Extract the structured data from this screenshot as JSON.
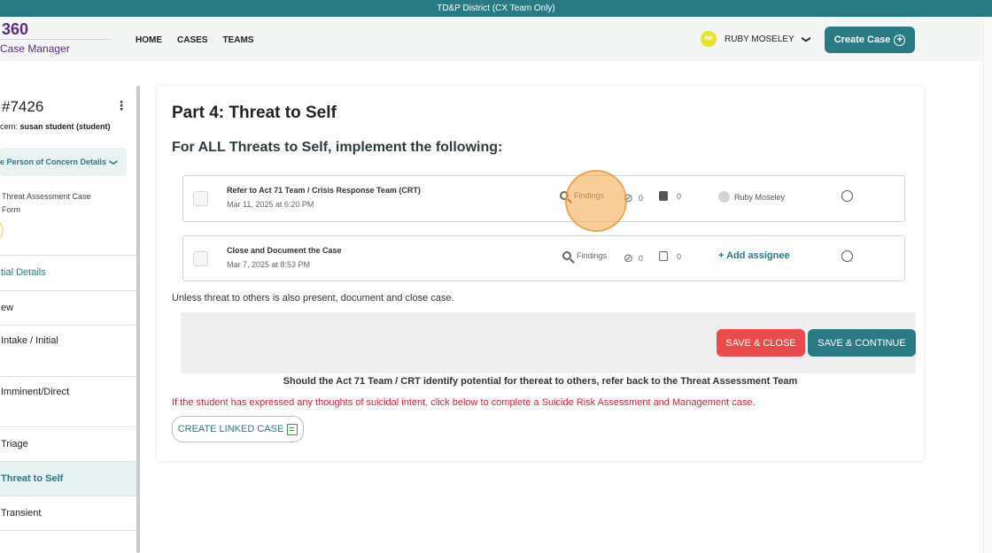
{
  "topbar": {
    "text": "TD&P District (CX Team Only)"
  },
  "header": {
    "logo_number": "360",
    "logo_subtitle": "Case Manager",
    "nav": [
      "HOME",
      "CASES",
      "TEAMS"
    ],
    "user": {
      "initials": "RM",
      "name": "RUBY MOSELEY",
      "caret": "❯"
    },
    "create_case": "Create Case",
    "plus": "+"
  },
  "sidebar": {
    "case_id": "#7426",
    "kebab": "⋮",
    "concern_prefix": "cern: ",
    "concern_name": "susan student (student)",
    "poc_button": "e Person of Concern Details",
    "poc_caret": "❯",
    "form_label_1": "Threat Assessment Case",
    "form_label_2": "Form",
    "items": [
      {
        "label": "tial Details"
      },
      {
        "label": "ew"
      },
      {
        "label": "Intake / Initial"
      },
      {
        "label": "Imminent/Direct"
      },
      {
        "label": "Triage"
      },
      {
        "label": "Threat to Self"
      },
      {
        "label": "Transient"
      }
    ]
  },
  "main": {
    "part_title": "Part 4: Threat to Self",
    "sub_title": "For ALL Threats to Self, implement the following:",
    "tasks": [
      {
        "title": "Refer to Act 71 Team / Crisis Response Team (CRT)",
        "date": "Mar 11, 2025 at 6:20 PM",
        "findings": "Findings",
        "attachments": "0",
        "notes": "0",
        "assignee": "Ruby Moseley"
      },
      {
        "title": "Close and Document the Case",
        "date": "Mar 7, 2025 at 8:53 PM",
        "findings": "Findings",
        "attachments": "0",
        "notes": "0",
        "assignee": "+ Add assignee"
      }
    ],
    "unless_text": "Unless threat to others is also present, document and close case.",
    "save_close": "SAVE & CLOSE",
    "save_continue": "SAVE & CONTINUE",
    "should_text": "Should the Act 71 Team / CRT identify potential for thereat to others, refer back to the Threat Assessment Team",
    "suicide_text": "If the student has expressed any thoughts of suicidal intent, click below to complete a Suicide Risk Assessment and Management case.",
    "linked_case": "CREATE LINKED CASE"
  },
  "colors": {
    "brand": "#2a7a84",
    "danger": "#eb4b4b",
    "logo": "#5a2d82",
    "alert_text": "#d6213a"
  }
}
